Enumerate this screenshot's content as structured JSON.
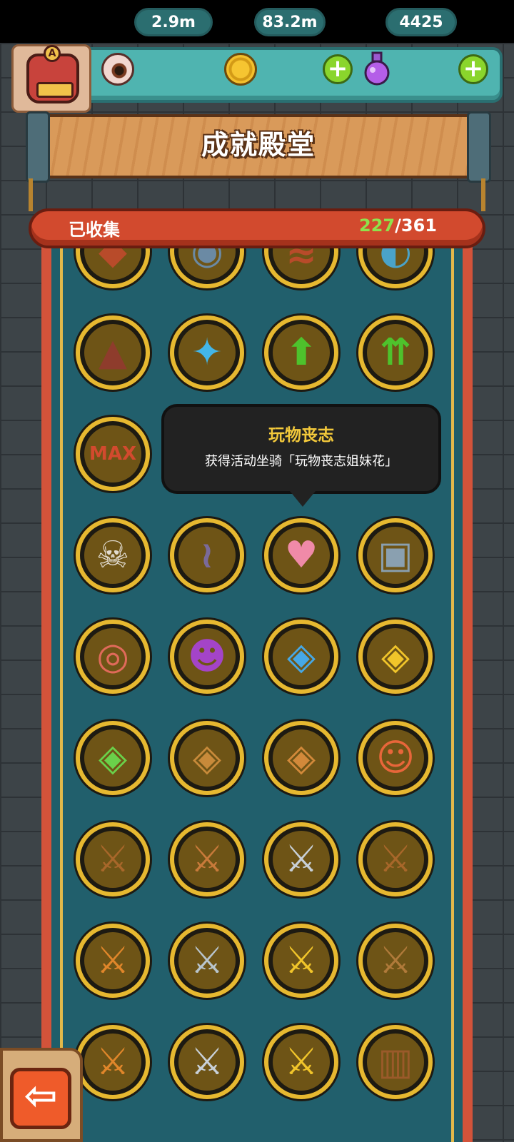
{
  "header": {
    "eyeballs": "2.9m",
    "coins": "83.2m",
    "potions": "4425",
    "avatar_badge": "A"
  },
  "title": "成就殿堂",
  "collection": {
    "label": "已收集",
    "collected": "227",
    "total_text": "/361"
  },
  "tooltip": {
    "title": "玩物丧志",
    "description": "获得活动坐骑「玩物丧志姐妹花」"
  },
  "medals": [
    {
      "icon": "crystal-rock-icon",
      "glyph": "◆",
      "color": "#b84b2a"
    },
    {
      "icon": "stone-face-icon",
      "glyph": "◉",
      "color": "#6b8aa4"
    },
    {
      "icon": "lava-crack-icon",
      "glyph": "≋",
      "color": "#b84b2a"
    },
    {
      "icon": "water-rock-icon",
      "glyph": "◐",
      "color": "#4aa3c9"
    },
    {
      "icon": "lava-rock-icon",
      "glyph": "▲",
      "color": "#8e3c2c"
    },
    {
      "icon": "ice-crystal-icon",
      "glyph": "✦",
      "color": "#43b6e8"
    },
    {
      "icon": "green-arrow-up-icon",
      "glyph": "⬆",
      "color": "#4ec22c"
    },
    {
      "icon": "double-green-arrow-icon",
      "glyph": "⇈",
      "color": "#4ec22c"
    },
    {
      "icon": "max-upgrade-icon",
      "glyph": "MAX",
      "color": "#d24a2e"
    },
    {
      "icon": "skull-icon",
      "glyph": "☠",
      "color": "#e2dcd0"
    },
    {
      "icon": "tentacles-icon",
      "glyph": "≀",
      "color": "#7a6a9a"
    },
    {
      "icon": "heart-roll-icon",
      "glyph": "♥",
      "color": "#f08aa8"
    },
    {
      "icon": "robot-skull-icon",
      "glyph": "▣",
      "color": "#8aa0b0"
    },
    {
      "icon": "snail-creature-icon",
      "glyph": "◎",
      "color": "#e06a5a"
    },
    {
      "icon": "purple-monster-icon",
      "glyph": "☻",
      "color": "#a444c8"
    },
    {
      "icon": "gem-pair-blue-icon",
      "glyph": "◈",
      "color": "#46a8e6"
    },
    {
      "icon": "gem-pair-yellow-icon",
      "glyph": "◈",
      "color": "#f1c52a"
    },
    {
      "icon": "gem-trio-color-icon",
      "glyph": "◈",
      "color": "#6ad14a"
    },
    {
      "icon": "gem-trio-bronze-icon",
      "glyph": "◈",
      "color": "#c88a3a"
    },
    {
      "icon": "gem-trio-copper-icon",
      "glyph": "◈",
      "color": "#d2893a"
    },
    {
      "icon": "red-hair-girl-icon",
      "glyph": "☺",
      "color": "#e8663a"
    },
    {
      "icon": "bronze-helmet-sword-icon",
      "glyph": "⚔",
      "color": "#a8672a"
    },
    {
      "icon": "copper-helmet-sword-icon",
      "glyph": "⚔",
      "color": "#c87a3a"
    },
    {
      "icon": "silver-helmet-sword-icon",
      "glyph": "⚔",
      "color": "#c8d0d8"
    },
    {
      "icon": "wood-helmet-sword-icon",
      "glyph": "⚔",
      "color": "#a8672a"
    },
    {
      "icon": "orange-helmet-sword-icon",
      "glyph": "⚔",
      "color": "#e0862a"
    },
    {
      "icon": "steel-helmet-sword-icon",
      "glyph": "⚔",
      "color": "#b8c4cc"
    },
    {
      "icon": "gold-helmet-sword-icon",
      "glyph": "⚔",
      "color": "#f1c52a"
    },
    {
      "icon": "wood-sword-fist-icon",
      "glyph": "⚔",
      "color": "#b07a3a"
    },
    {
      "icon": "orange-sword-fist-icon",
      "glyph": "⚔",
      "color": "#e0862a"
    },
    {
      "icon": "silver-sword-fist-icon",
      "glyph": "⚔",
      "color": "#c8d0d8"
    },
    {
      "icon": "gold-sword-fist-icon",
      "glyph": "⚔",
      "color": "#f1c52a"
    },
    {
      "icon": "wooden-cage-icon",
      "glyph": "▥",
      "color": "#9a5a2a"
    }
  ]
}
